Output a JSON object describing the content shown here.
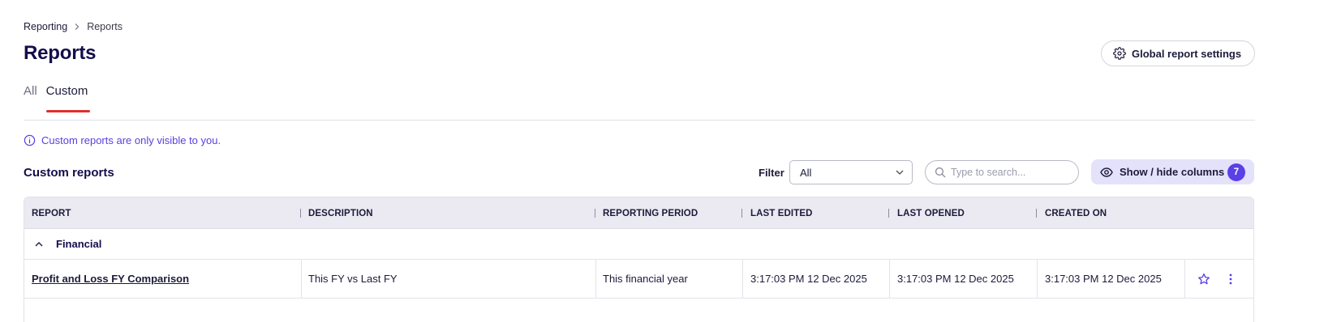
{
  "breadcrumb": {
    "parent": "Reporting",
    "current": "Reports"
  },
  "page": {
    "title": "Reports"
  },
  "header": {
    "global_settings_label": "Global report settings"
  },
  "tabs": [
    {
      "label": "All",
      "active": false
    },
    {
      "label": "Custom",
      "active": true
    }
  ],
  "info": {
    "text": "Custom reports are only visible to you."
  },
  "section": {
    "title": "Custom reports"
  },
  "toolbar": {
    "filter_label": "Filter",
    "filter_value": "All",
    "search_placeholder": "Type to search...",
    "columns_label": "Show / hide columns",
    "columns_count": "7"
  },
  "table": {
    "columns": [
      "REPORT",
      "DESCRIPTION",
      "REPORTING PERIOD",
      "LAST EDITED",
      "LAST OPENED",
      "CREATED ON"
    ],
    "group": {
      "label": "Financial",
      "expanded": true
    },
    "rows": [
      {
        "report": "Profit and Loss FY Comparison",
        "description": "This FY vs Last FY",
        "period": "This financial year",
        "last_edited": "3:17:03 PM 12 Dec 2025",
        "last_opened": "3:17:03 PM 12 Dec 2025",
        "created_on": "3:17:03 PM 12 Dec 2025",
        "favourite": false
      }
    ]
  },
  "colors": {
    "accent": "#5b3fe8",
    "title": "#140d4a",
    "tab_underline": "#e02d2d",
    "header_bg": "#ebeaf2",
    "columns_button_bg": "#e4e2fa"
  },
  "icons": {
    "breadcrumb_separator": "chevron-right-icon",
    "settings": "gear-icon",
    "info": "info-icon",
    "dropdown": "chevron-down-icon",
    "search": "search-icon",
    "columns": "eye-icon",
    "group_toggle": "chevron-up-icon",
    "favourite": "star-icon",
    "more": "more-vertical-icon"
  }
}
